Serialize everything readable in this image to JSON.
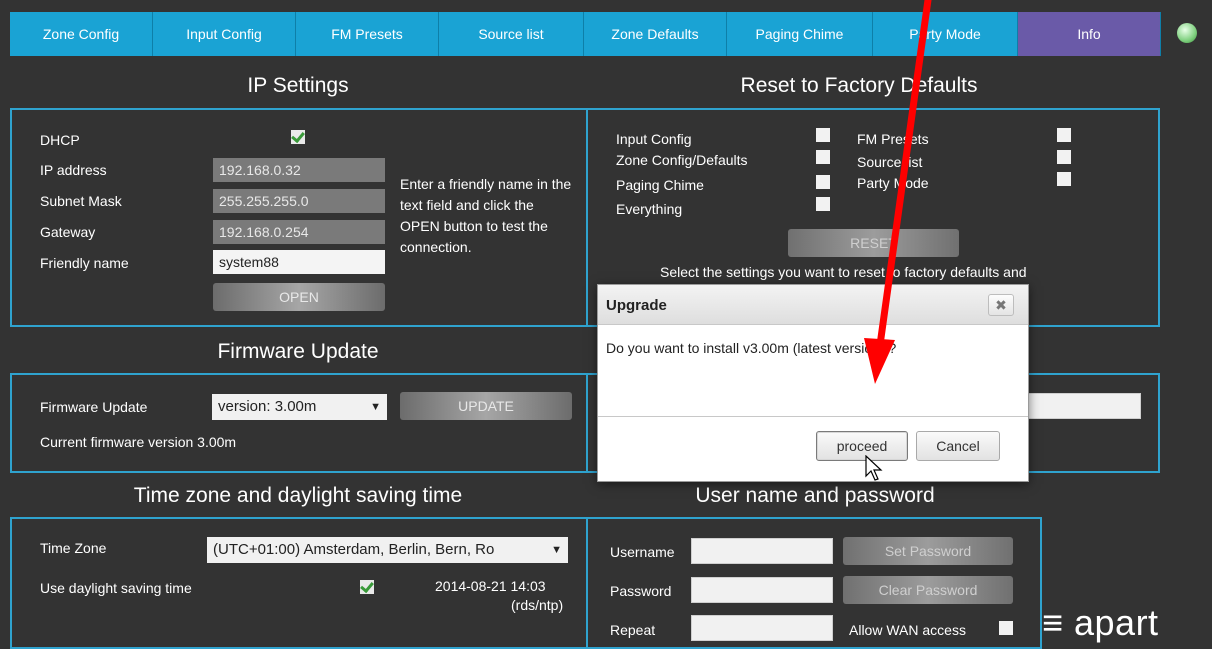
{
  "tabs": [
    {
      "label": "Zone Config"
    },
    {
      "label": "Input Config"
    },
    {
      "label": "FM Presets"
    },
    {
      "label": "Source list"
    },
    {
      "label": "Zone Defaults"
    },
    {
      "label": "Paging Chime"
    },
    {
      "label": "Party Mode"
    },
    {
      "label": "Info",
      "active": true
    }
  ],
  "ip": {
    "title": "IP Settings",
    "dhcp_label": "DHCP",
    "dhcp_checked": true,
    "ip_label": "IP address",
    "ip_value": "192.168.0.32",
    "subnet_label": "Subnet Mask",
    "subnet_value": "255.255.255.0",
    "gateway_label": "Gateway",
    "gateway_value": "192.168.0.254",
    "friendly_label": "Friendly name",
    "friendly_value": "system88",
    "open_label": "OPEN",
    "help": "Enter a friendly name in the text field and click the OPEN button to test the connection."
  },
  "reset": {
    "title": "Reset to Factory Defaults",
    "input_config": "Input Config",
    "zone_config": "Zone Config/Defaults",
    "paging_chime": "Paging Chime",
    "everything": "Everything",
    "fm_presets": "FM Presets",
    "source_list": "Source list",
    "party_mode": "Party Mode",
    "reset_label": "RESET",
    "note": "Select the settings you want to reset to factory defaults and"
  },
  "firmware": {
    "title": "Firmware Update",
    "label": "Firmware Update",
    "version_select": "version: 3.00m",
    "update_label": "UPDATE",
    "current": "Current firmware version 3.00m"
  },
  "timezone": {
    "title": "Time zone and daylight saving time",
    "tz_label": "Time Zone",
    "tz_value": "(UTC+01:00) Amsterdam, Berlin, Bern, Ro",
    "dst_label": "Use daylight saving time",
    "dst_checked": true,
    "datetime": "2014-08-21 14:03",
    "source": "(rds/ntp)"
  },
  "user": {
    "title": "User name and password",
    "username_label": "Username",
    "password_label": "Password",
    "repeat_label": "Repeat",
    "set_password": "Set Password",
    "clear_password": "Clear Password",
    "allow_wan": "Allow WAN access"
  },
  "dialog": {
    "title": "Upgrade",
    "close_glyph": "✖",
    "message": "Do you want to install v3.00m (latest version) ?",
    "proceed": "proceed",
    "cancel": "Cancel"
  },
  "logo": "≡ apart",
  "colors": {
    "tab": "#1aa3d4",
    "tab_active": "#6a5aa8",
    "panel_border": "#2fa3cf",
    "background": "#333333",
    "annotation_arrow": "#ff0000"
  }
}
